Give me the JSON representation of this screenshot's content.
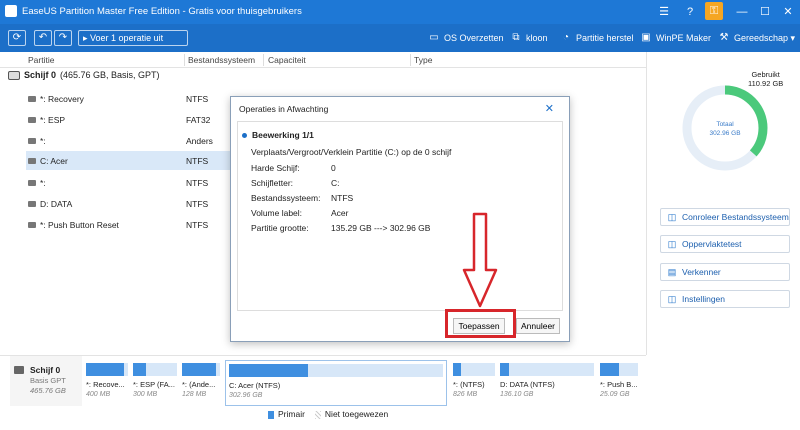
{
  "window": {
    "title": "EaseUS Partition Master Free Edition - Gratis voor thuisgebruikers",
    "controls": [
      "☰",
      "?",
      "⚿",
      "—",
      "☐",
      "✕"
    ]
  },
  "toolbar": {
    "refresh": "⟳",
    "undo": "↶",
    "redo": "↷",
    "pending_label": "Voer 1 operatie uit",
    "actions": [
      {
        "icon": "▭",
        "label": "OS Overzetten"
      },
      {
        "icon": "⧉",
        "label": "kloon"
      },
      {
        "icon": "◔",
        "label": "Partitie herstel"
      },
      {
        "icon": "▣",
        "label": "WinPE Maker"
      },
      {
        "icon": "⚒",
        "label": "Gereedschap ▾"
      }
    ]
  },
  "columns": {
    "partitie": "Partitie",
    "bestandssysteem": "Bestandssysteem",
    "capaciteit": "Capaciteit",
    "type": "Type"
  },
  "disk": {
    "name": "Schijf 0",
    "info": "(465.76 GB, Basis, GPT)"
  },
  "partitions": [
    {
      "name": "*: Recovery",
      "fs": "NTFS"
    },
    {
      "name": "*: ESP",
      "fs": "FAT32"
    },
    {
      "name": "*:",
      "fs": "Anders"
    },
    {
      "name": "C: Acer",
      "fs": "NTFS"
    },
    {
      "name": "*:",
      "fs": "NTFS"
    },
    {
      "name": "D: DATA",
      "fs": "NTFS"
    },
    {
      "name": "*: Push Button Reset",
      "fs": "NTFS"
    }
  ],
  "right_panel": {
    "used_label": "Gebruikt",
    "used_value": "110.92 GB",
    "total_label": "Totaal",
    "total_value": "302.96 GB",
    "used_fraction": 0.366,
    "buttons": [
      {
        "icon": "◫",
        "label": "Conroleer Bestandssysteem"
      },
      {
        "icon": "◫",
        "label": "Oppervlaktetest"
      },
      {
        "icon": "▤",
        "label": "Verkenner"
      },
      {
        "icon": "◫",
        "label": "Instellingen"
      }
    ]
  },
  "dialog": {
    "title": "Operaties in Afwachting",
    "close": "✕",
    "operation": "Beewerking 1/1",
    "description": "Verplaats/Vergroot/Verklein Partitie (C:) op de 0 schijf",
    "details": [
      {
        "k": "Harde Schijf:",
        "v": "0"
      },
      {
        "k": "Schijfletter:",
        "v": "C:"
      },
      {
        "k": "Bestandssysteem:",
        "v": "NTFS"
      },
      {
        "k": "Volume label:",
        "v": "Acer"
      },
      {
        "k": "Partitie grootte:",
        "v": "135.29 GB ---> 302.96 GB"
      }
    ],
    "apply": "Toepassen",
    "cancel": "Annuleer"
  },
  "bottom": {
    "disk_name": "Schijf 0",
    "disk_type": "Basis GPT",
    "disk_size": "465.76 GB",
    "parts": [
      {
        "label": "*: Recove...",
        "size": "400 MB",
        "fill": 0.9
      },
      {
        "label": "*: ESP (FA...",
        "size": "300 MB",
        "fill": 0.3
      },
      {
        "label": "*: (Ande...",
        "size": "128 MB",
        "fill": 0.9
      },
      {
        "label": "C: Acer (NTFS)",
        "size": "302.96 GB",
        "fill": 0.37
      },
      {
        "label": "*: (NTFS)",
        "size": "826 MB",
        "fill": 0.2
      },
      {
        "label": "D: DATA (NTFS)",
        "size": "136.10 GB",
        "fill": 0.1
      },
      {
        "label": "*: Push B...",
        "size": "25.09 GB",
        "fill": 0.5
      }
    ]
  },
  "legend": {
    "primary": "Primair",
    "unallocated": "Niet toegewezen"
  },
  "colors": {
    "titlebar": "#1e78d6",
    "toolbar": "#1c6fc8",
    "used_arc": "#4bc97b",
    "highlight": "#d7262b"
  }
}
